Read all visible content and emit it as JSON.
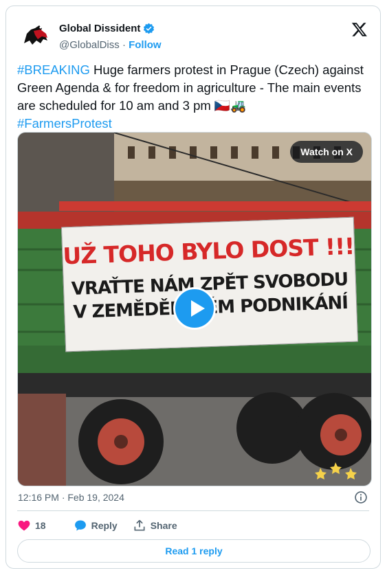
{
  "author": {
    "name": "Global Dissident",
    "handle": "@GlobalDiss",
    "separator": "·",
    "follow_label": "Follow"
  },
  "tweet": {
    "hashtag_breaking": "#BREAKING",
    "body": " Huge farmers protest in Prague (Czech) against Green Agenda & for freedom in agriculture - The main events are scheduled for 10 am and 3 pm ",
    "emoji": "🇨🇿🚜",
    "hashtag_protest": "#FarmersProtest"
  },
  "media": {
    "watch_label": "Watch on X",
    "banner_line1": "UŽ TOHO BYLO DOST !!!",
    "banner_line2": "VRAŤTE NÁM ZPĚT SVOBODU",
    "banner_line3": "V ZEMĚDĚLSKÉM PODNIKÁNÍ"
  },
  "meta": {
    "timestamp": "12:16 PM · Feb 19, 2024"
  },
  "actions": {
    "like_count": "18",
    "reply_label": "Reply",
    "share_label": "Share",
    "read_replies_label": "Read 1 reply"
  },
  "colors": {
    "accent": "#1d9bf0",
    "like": "#f91880",
    "muted": "#536471"
  }
}
